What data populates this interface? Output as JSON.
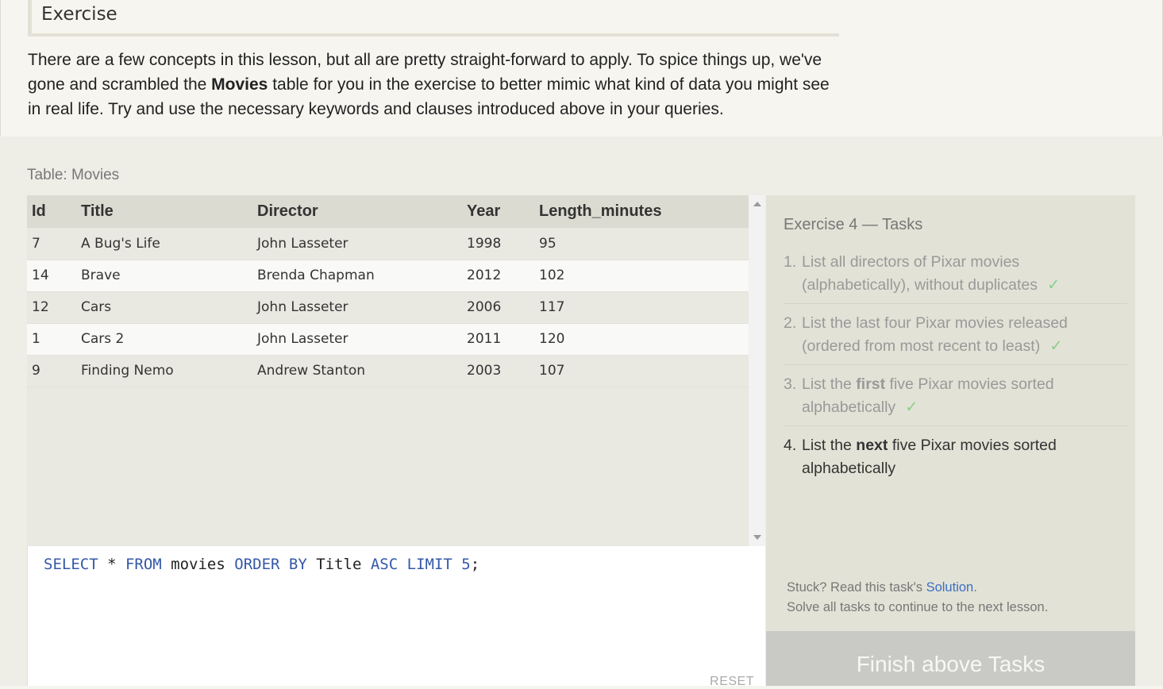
{
  "heading": "Exercise",
  "intro": {
    "before": "There are a few concepts in this lesson, but all are pretty straight-forward to apply. To spice things up, we've gone and scrambled the ",
    "bold": "Movies",
    "after": " table for you in the exercise to better mimic what kind of data you might see in real life. Try and use the necessary keywords and clauses introduced above in your queries."
  },
  "table": {
    "label": "Table: Movies",
    "columns": [
      "Id",
      "Title",
      "Director",
      "Year",
      "Length_minutes"
    ],
    "rows": [
      [
        "7",
        "A Bug's Life",
        "John Lasseter",
        "1998",
        "95"
      ],
      [
        "14",
        "Brave",
        "Brenda Chapman",
        "2012",
        "102"
      ],
      [
        "12",
        "Cars",
        "John Lasseter",
        "2006",
        "117"
      ],
      [
        "1",
        "Cars 2",
        "John Lasseter",
        "2011",
        "120"
      ],
      [
        "9",
        "Finding Nemo",
        "Andrew Stanton",
        "2003",
        "107"
      ]
    ]
  },
  "editor": {
    "tokens": [
      {
        "t": "SELECT",
        "kw": true
      },
      {
        "t": " * ",
        "kw": false
      },
      {
        "t": "FROM",
        "kw": true
      },
      {
        "t": " movies ",
        "kw": false
      },
      {
        "t": "ORDER BY",
        "kw": true
      },
      {
        "t": " Title ",
        "kw": false
      },
      {
        "t": "ASC",
        "kw": true
      },
      {
        "t": " ",
        "kw": false
      },
      {
        "t": "LIMIT",
        "kw": true
      },
      {
        "t": " ",
        "kw": false
      },
      {
        "t": "5",
        "kw": true
      },
      {
        "t": ";",
        "kw": false
      }
    ],
    "reset_label": "RESET"
  },
  "tasks": {
    "title": "Exercise 4 — Tasks",
    "items": [
      {
        "num": "1.",
        "pre": "List all directors of Pixar movies (alphabetically), without duplicates",
        "bold": "",
        "post": "",
        "done": true
      },
      {
        "num": "2.",
        "pre": "List the last four Pixar movies released (ordered from most recent to least)",
        "bold": "",
        "post": "",
        "done": true
      },
      {
        "num": "3.",
        "pre": "List the ",
        "bold": "first",
        "post": " five Pixar movies sorted alphabetically",
        "done": true
      },
      {
        "num": "4.",
        "pre": "List the ",
        "bold": "next",
        "post": " five Pixar movies sorted alphabetically",
        "done": false
      }
    ],
    "check_mark": "✓",
    "stuck_pre": "Stuck? Read this task's ",
    "stuck_link": "Solution",
    "stuck_post": ".",
    "solve_all": "Solve all tasks to continue to the next lesson.",
    "finish_label": "Finish above Tasks"
  }
}
